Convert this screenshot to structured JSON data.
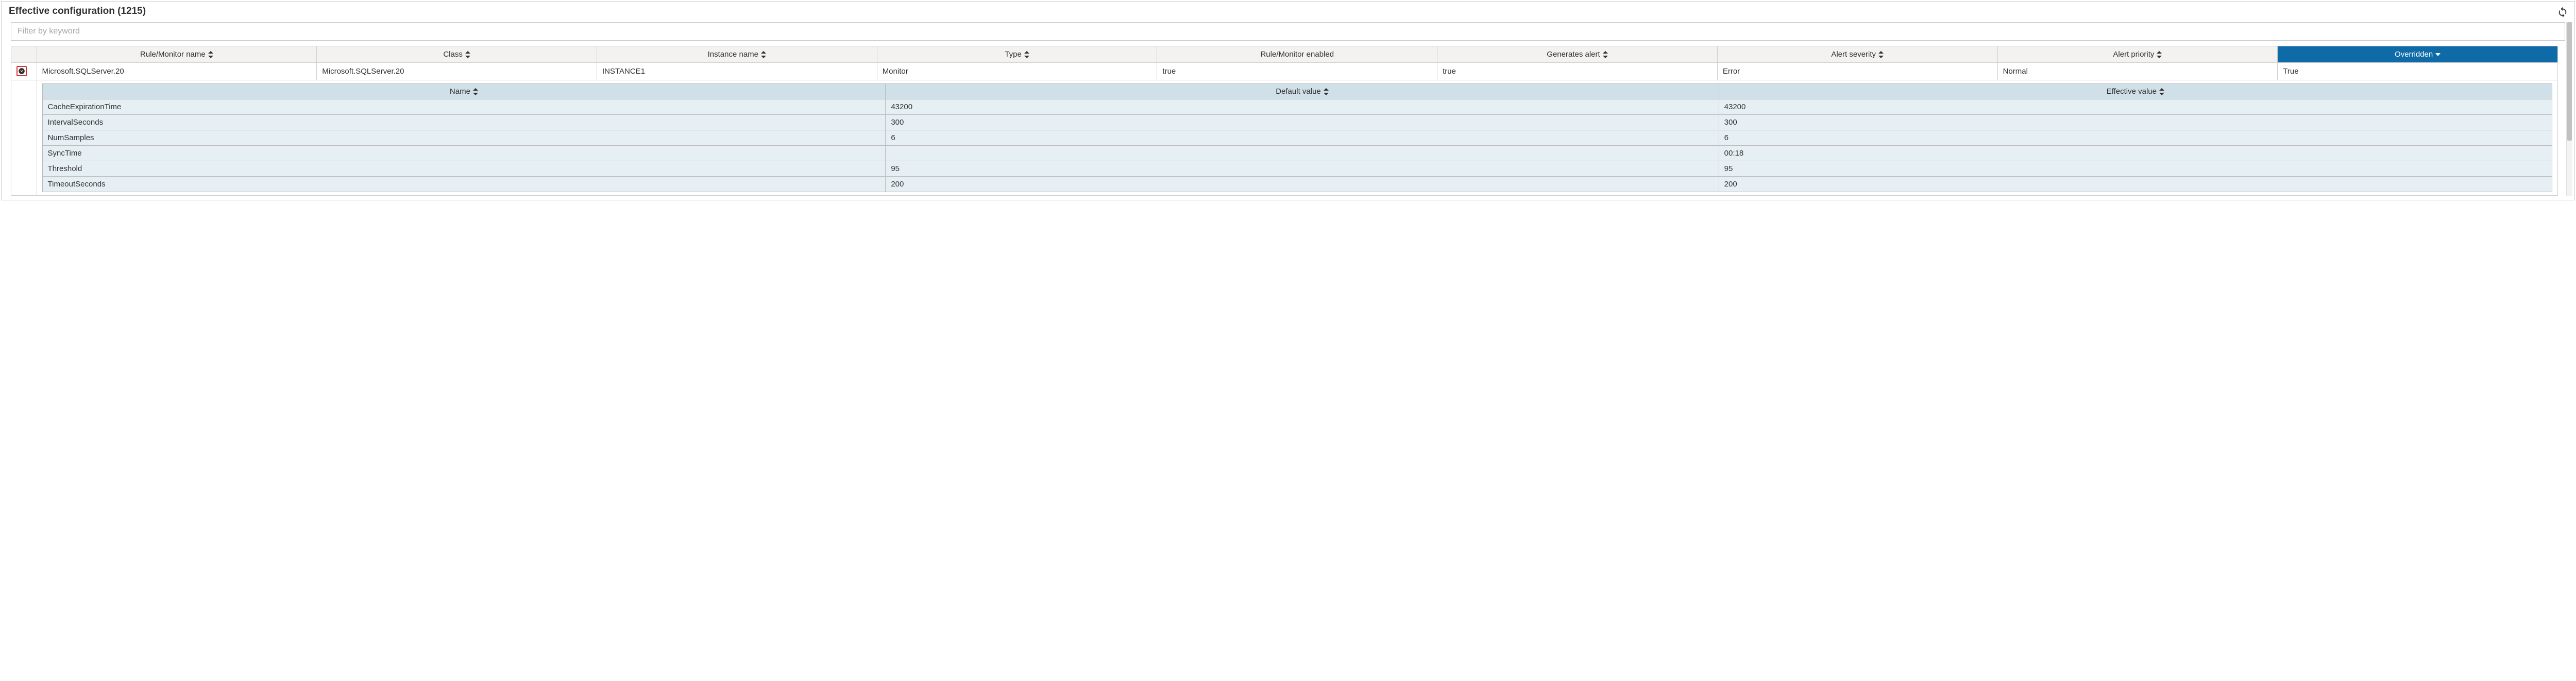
{
  "panel": {
    "title": "Effective configuration (1215)"
  },
  "filter": {
    "placeholder": "Filter by keyword",
    "value": ""
  },
  "columns": {
    "rule_name": {
      "label": "Rule/Monitor name",
      "sortable": true,
      "active": false
    },
    "class": {
      "label": "Class",
      "sortable": true,
      "active": false
    },
    "instance": {
      "label": "Instance name",
      "sortable": true,
      "active": false
    },
    "type": {
      "label": "Type",
      "sortable": true,
      "active": false
    },
    "enabled": {
      "label": "Rule/Monitor enabled",
      "sortable": false,
      "active": false
    },
    "generates": {
      "label": "Generates alert",
      "sortable": true,
      "active": false
    },
    "severity": {
      "label": "Alert severity",
      "sortable": true,
      "active": false
    },
    "priority": {
      "label": "Alert priority",
      "sortable": true,
      "active": false
    },
    "overridden": {
      "label": "Overridden",
      "sortable": true,
      "active": true,
      "dir": "desc"
    }
  },
  "row": {
    "rule_name": "Microsoft.SQLServer.20",
    "class": "Microsoft.SQLServer.20",
    "instance": "INSTANCE1",
    "type": "Monitor",
    "enabled": "true",
    "generates": "true",
    "severity": "Error",
    "priority": "Normal",
    "overridden": "True"
  },
  "detail_columns": {
    "name": {
      "label": "Name"
    },
    "default": {
      "label": "Default value"
    },
    "effective": {
      "label": "Effective value"
    }
  },
  "details": [
    {
      "name": "CacheExpirationTime",
      "default": "43200",
      "effective": "43200"
    },
    {
      "name": "IntervalSeconds",
      "default": "300",
      "effective": "300"
    },
    {
      "name": "NumSamples",
      "default": "6",
      "effective": "6"
    },
    {
      "name": "SyncTime",
      "default": "",
      "effective": "00:18"
    },
    {
      "name": "Threshold",
      "default": "95",
      "effective": "95"
    },
    {
      "name": "TimeoutSeconds",
      "default": "200",
      "effective": "200"
    }
  ]
}
